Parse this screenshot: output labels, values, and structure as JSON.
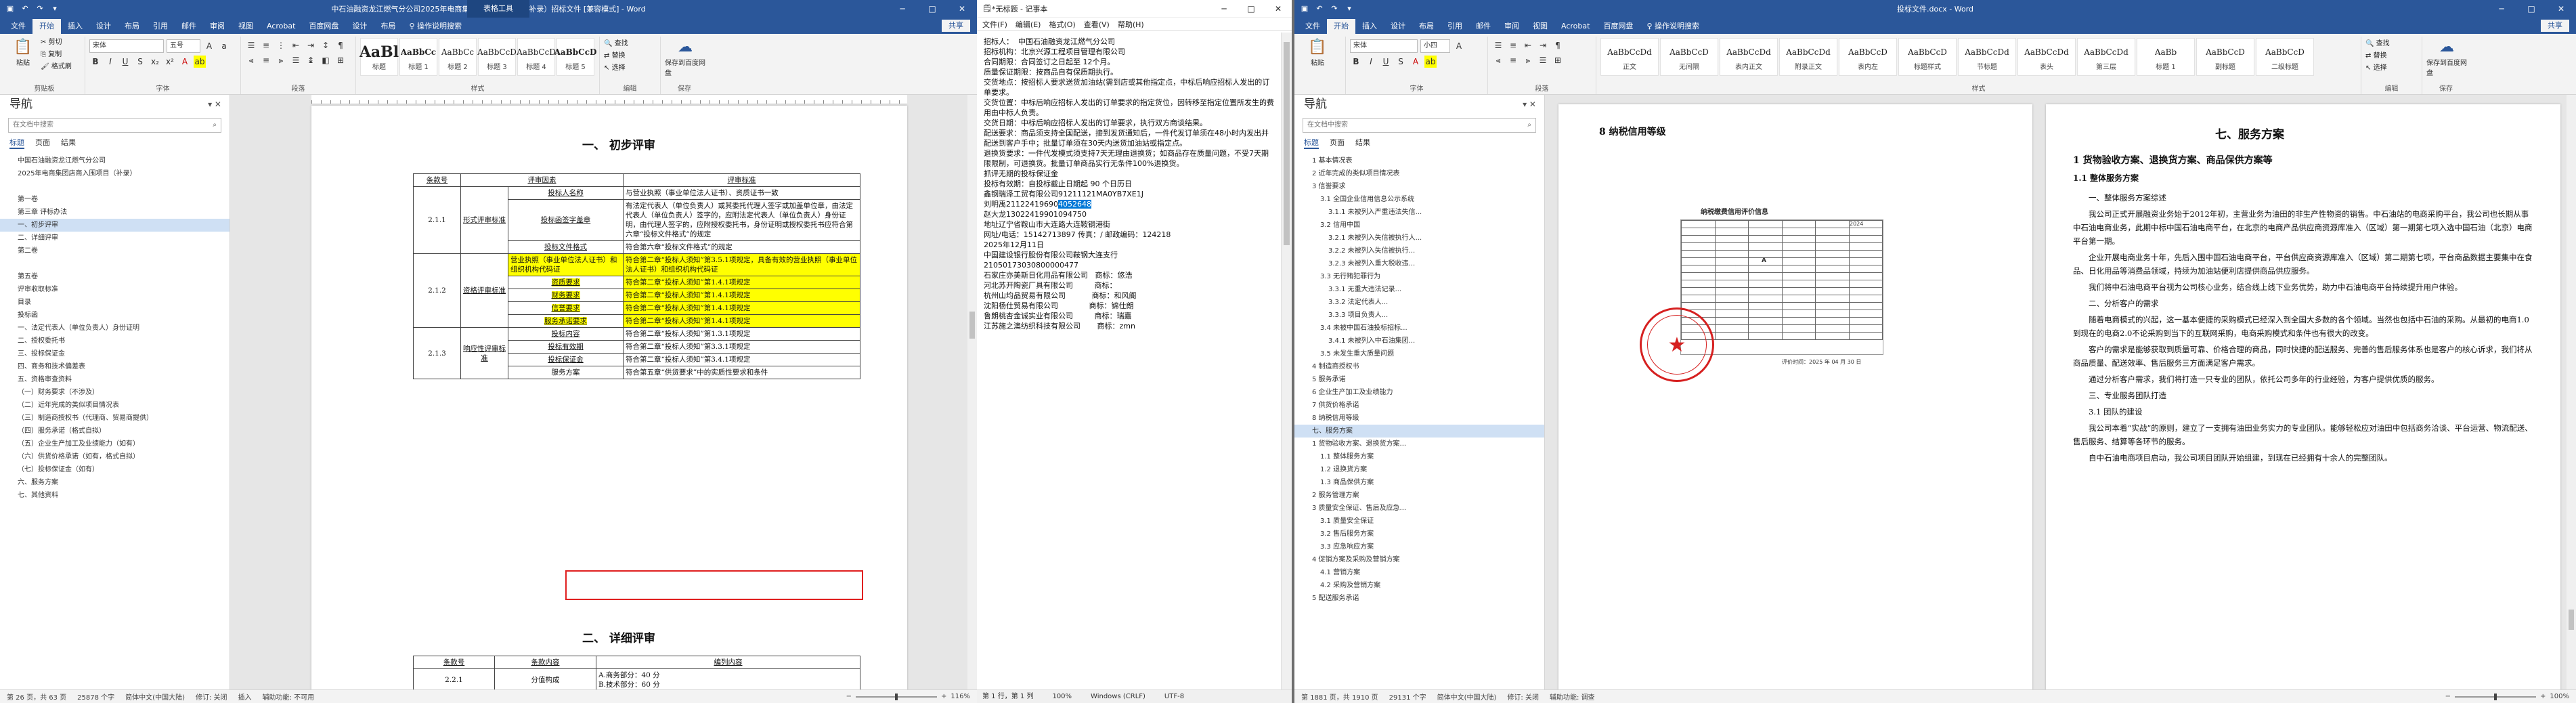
{
  "left_word": {
    "title_doc": "中石油融资龙江燃气分公司2025年电商集团店商入围项目（补录）招标文件 [兼容模式] - Word",
    "title_tool": "表格工具",
    "tabs": [
      "文件",
      "开始",
      "插入",
      "设计",
      "布局",
      "引用",
      "邮件",
      "审阅",
      "视图",
      "Acrobat",
      "百度网盘",
      "设计",
      "布局",
      "操作说明搜索"
    ],
    "share": "共享",
    "ribbon": {
      "paste": "粘贴",
      "cut": "剪切",
      "copy": "复制",
      "format_painter": "格式刷",
      "clipboard": "剪贴板",
      "font_name": "宋体",
      "font_size": "五号",
      "font_group": "字体",
      "para_group": "段落",
      "styles_group": "样式",
      "find": "查找",
      "replace": "替换",
      "select": "选择",
      "edit_group": "编辑",
      "save_baidu": "保存到百度网盘",
      "save_group": "保存"
    },
    "styles": [
      {
        "sample": "AaBl",
        "name": "标题"
      },
      {
        "sample": "AaBbCc",
        "name": "标题 1"
      },
      {
        "sample": "AaBbCc",
        "name": "标题 2"
      },
      {
        "sample": "AaBbCcD",
        "name": "标题 3"
      },
      {
        "sample": "AaBbCcD",
        "name": "标题 4"
      },
      {
        "sample": "AaBbCcD",
        "name": "标题 5"
      }
    ],
    "nav": {
      "title": "导航",
      "search_placeholder": "在文档中搜索",
      "tabs": [
        "标题",
        "页面",
        "结果"
      ],
      "items": [
        "中国石油融资龙江燃气分公司",
        "2025年电商集团店商入围项目（补录）",
        "",
        "第一卷",
        "第三章 评标办法",
        "一、初步评审",
        "二、详细评审",
        "第二卷",
        "",
        "第五卷",
        "评审收取标准",
        "目录",
        "投标函",
        "一、法定代表人（单位负责人）身份证明",
        "二、授权委托书",
        "三、投标保证金",
        "四、商务和技术偏差表",
        "五、资格审查资料",
        "（一）财务要求（不涉及）",
        "（二）近年完成的类似项目情况表",
        "（三）制造商授权书（代理商、贸易商提供）",
        "（四）服务承诺（格式自拟）",
        "（五）企业生产加工及业绩能力（如有）",
        "（六）供货价格承诺（如有，格式自拟）",
        "（七）投标保证金（如有）",
        "六、服务方案",
        "七、其他资料"
      ],
      "selected": 5
    },
    "doc": {
      "heading1": "一、    初步评审",
      "headers": [
        "条款号",
        "评审因素",
        "评审标准"
      ],
      "clause_1": "2.1.1",
      "clause_2": "2.1.2",
      "clause_3": "2.1.3",
      "cat_1": "形式评审标准",
      "cat_2": "资格评审标准",
      "cat_3": "响应性评审标准",
      "rows": [
        {
          "factor": "投标人名称",
          "std": "与营业执照（事业单位法人证书）、资质证书一致"
        },
        {
          "factor": "投标函签字盖章",
          "std": "有法定代表人（单位负责人）或其委托代理人签字或加盖单位章，由法定代表人（单位负责人）签字的，应附法定代表人（单位负责人）身份证明，由代理人签字的，应附授权委托书，身份证明或授权委托书应符合第六章“投标文件格式”的规定"
        },
        {
          "factor": "投标文件格式",
          "std": "符合第六章“投标文件格式”的规定"
        },
        {
          "factor": "营业执照（事业单位法人证书）和组织机构代码证",
          "std": "符合第二章“投标人须知”第3.5.1项规定，具备有效的营业执照（事业单位法人证书）和组织机构代码证"
        },
        {
          "factor": "资质要求",
          "std": "符合第二章“投标人须知”第1.4.1项规定"
        },
        {
          "factor": "财务要求",
          "std": "符合第二章“投标人须知”第1.4.1项规定"
        },
        {
          "factor": "信誉要求",
          "std": "符合第二章“投标人须知”第1.4.1项规定"
        },
        {
          "factor": "服务承诺要求",
          "std": "符合第二章“投标人须知”第1.4.1项规定"
        },
        {
          "factor": "投标内容",
          "std": "符合第二章“投标人须知”第1.3.1项规定"
        },
        {
          "factor": "投标有效期",
          "std": "符合第二章“投标人须知”第3.3.1项规定"
        },
        {
          "factor": "投标保证金",
          "std": "符合第二章“投标人须知”第3.4.1项规定"
        },
        {
          "factor": "服务方案",
          "std": "符合第五章“供货要求”中的实质性要求和条件"
        }
      ],
      "heading2": "二、    详细评审",
      "headers2": [
        "条款号",
        "条款内容",
        "编列内容"
      ],
      "d_clause": "2.2.1",
      "d_factor": "分值构成",
      "d_std": "A.商务部分：40 分\nB.技术部分：60 分"
    },
    "status": {
      "page": "第 26 页，共 63 页",
      "words": "25878 个字",
      "lang": "简体中文(中国大陆)",
      "track": "修订: 关闭",
      "insert": "插入",
      "access": "辅助功能: 不可用",
      "zoom": "116%"
    }
  },
  "notepad": {
    "title": "*无标题 - 记事本",
    "menu": [
      "文件(F)",
      "编辑(E)",
      "格式(O)",
      "查看(V)",
      "帮助(H)"
    ],
    "lines": [
      "招标人：  中国石油融资龙江燃气分公司",
      "",
      "招标机构：北京兴源工程项目管理有限公司",
      "",
      "合同期限：合同签订之日起至 12个月。",
      "",
      "质量保证期限：按商品自有保质期执行。",
      "",
      "交货地点：按招标人要求送货加油站(需到店或其他指定点，中标后响应招标人发出的订单要求。",
      "交货位置：中标后响应招标人发出的订单要求的指定货位，因转移至指定位置所发生的费用由中标人负责。",
      "",
      "交货日期：中标后响应招标人发出的订单要求，执行双方商谈结果。",
      "",
      "配送要求：商品须支持全国配送，接到发货通知后，一件代发订单须在48小时内发出并配送到客户手中；批量订单须在30天内送货加油站或指定点。",
      "",
      "退换货要求：一件代发模式须支持7天无理由退换货；如商品存在质量问题，不受7天期限限制，可退换货。批量订单商品实行无条件100%退换货。",
      "",
      "抓评无期的投标保证金",
      "",
      "投标有效期：自投标截止日期起 90 个日历日",
      "",
      "鑫钢瑞泽工贸有限公司91211121MA0YB7XE1J",
      "刘明禹21122419690",
      "赵大龙13022419901094750",
      "地址辽宁省鞍山市大连路大连鞍钢港街",
      "网址/电话：15142713897 传真：/ 邮政编码：124218",
      "2025年12月11日",
      "",
      "中国建设银行股份有限公司鞍钢大连支行",
      "21050173030800000477",
      "",
      "石家庄亦美斯日化用品有限公司   商标：悠浩",
      "河北苏开陶瓷厂具有限公司         商标：",
      "杭州山均品贸易有限公司           商标：和风阁",
      "沈阳杨仕贸易有限公司             商标：锦仕朗",
      "鲁朗桃杏金诚实业有限公司         商标：瑞嘉",
      "江苏施之澳纺织科技有限公司       商标：zmn"
    ],
    "selected_text": "4052648",
    "status": [
      "第 1 行，第 1 列",
      "100%",
      "Windows (CRLF)",
      "UTF-8"
    ]
  },
  "right_word": {
    "title_doc": "投标文件.docx - Word",
    "tabs": [
      "文件",
      "开始",
      "插入",
      "设计",
      "布局",
      "引用",
      "邮件",
      "审阅",
      "视图",
      "Acrobat",
      "百度网盘",
      "操作说明搜索"
    ],
    "share": "共享",
    "ribbon": {
      "paste": "粘贴",
      "font_name": "宋体",
      "font_size": "小四",
      "font_group": "字体",
      "para_group": "段落",
      "styles_group": "样式",
      "edit_group": "编辑",
      "save_group": "保存",
      "find": "查找",
      "replace": "替换",
      "select": "选择",
      "save_baidu": "保存到百度网盘"
    },
    "styles": [
      {
        "sample": "AaBbCcDd",
        "name": "正文"
      },
      {
        "sample": "AaBbCcD",
        "name": "无间隔"
      },
      {
        "sample": "AaBbCcDd",
        "name": "表内正文"
      },
      {
        "sample": "AaBbCcDd",
        "name": "附录正文"
      },
      {
        "sample": "AaBbCcD",
        "name": "表内左"
      },
      {
        "sample": "AaBbCcD",
        "name": "标题样式"
      },
      {
        "sample": "AaBbCcDd",
        "name": "节标题"
      },
      {
        "sample": "AaBbCcDd",
        "name": "表头"
      },
      {
        "sample": "AaBbCcDd",
        "name": "第三层"
      },
      {
        "sample": "AaBb",
        "name": "标题 1"
      },
      {
        "sample": "AaBbCcD",
        "name": "副标题"
      },
      {
        "sample": "AaBbCcD",
        "name": "二级标题"
      }
    ],
    "nav": {
      "title": "导航",
      "search_placeholder": "在文档中搜索",
      "tabs": [
        "标题",
        "页面",
        "结果"
      ],
      "items": [
        "1 基本情况表",
        "2 近年完成的类似项目情况表",
        "3 信誉要求",
        "3.1 全国企业信用信息公示系统",
        "3.1.1 未被列入严重违法失信...",
        "3.2 信用中国",
        "3.2.1 未被列入失信被执行人...",
        "3.2.2 未被列入失信被执行...",
        "3.2.3 未被列入重大税收违...",
        "3.3 无行贿犯罪行为",
        "3.3.1 无重大违法记录...",
        "3.3.2 法定代表人...",
        "3.3.3 项目负责人...",
        "3.4 未被中国石油投标招标...",
        "3.4.1 未被列入中石油集团...",
        "3.5 未发生重大质量问题",
        "4 制造商授权书",
        "5 服务承诺",
        "6 企业生产加工及业绩能力",
        "7 供货价格承诺",
        "8 纳税信用等级",
        "七、服务方案",
        "1 货物验收方案、退换货方案...",
        "1.1 整体服务方案",
        "1.2 退换货方案",
        "1.3 商品保供方案",
        "2 服务管理方案",
        "3 质量安全保证、售后及应急...",
        "3.1 质量安全保证",
        "3.2 售后服务方案",
        "3.3 应急响应方案",
        "4 促销方案及采购及营销方案",
        "4.1 营销方案",
        "4.2 采购及营销方案",
        "5 配送服务承诺"
      ],
      "selected": 21
    },
    "page1": {
      "heading": "8   纳税信用等级",
      "cert_title": "纳税缴费信用评价信息",
      "cert_year": "2024",
      "cert_level": "A",
      "cert_footer": "评价时间：2025 年 04 月 30 日"
    },
    "page2": {
      "h1": "七、服务方案",
      "h2": "1   货物验收方案、退换货方案、商品保供方案等",
      "h3": "1.1   整体服务方案",
      "p": [
        "一、整体服务方案综述",
        "我公司正式开展融资业务始于2012年初，主营业务为油田的非生产性物资的销售。中石油站的电商采购平台，我公司也长期从事中石油电商业务，此期中标中国石油电商平台，在北京的电商产品供应商资源库准入（区域）第一期第七项入选中国石油（北京）电商平台第一期。",
        "企业开展电商业务十年，先后入围中国石油电商平台，平台供应商资源库准入（区域）第二期第七项，平台商品数据主要集中在食品、日化用品等消费品领域，持续为加油站便利店提供商品供应服务。",
        "我们将中石油电商平台视为公司核心业务，结合线上线下业务优势，助力中石油电商平台持续提升用户体验。",
        "二、分析客户的需求",
        "随着电商模式的兴起，这一基本便捷的采购模式已经深入到全国大多数的各个领域。当然也包括中石油的采购。从最初的电商1.0到现在的电商2.0不论采购到当下的互联网采购，电商采购模式和条件也有很大的改变。",
        "客户的需求是能够获取到质量可靠、价格合理的商品，同时快捷的配送服务、完善的售后服务体系也是客户的核心诉求，我们将从商品质量、配送效率、售后服务三方面满足客户需求。",
        "通过分析客户需求，我们将打造一只专业的团队，依托公司多年的行业经验，为客户提供优质的服务。",
        "三、专业服务团队打造",
        "3.1 团队的建设",
        "我公司本着“实战”的原则，建立了一支拥有油田业务实力的专业团队。能够轻松应对油田中包括商务洽谈、平台运营、物流配送、售后服务、结算等各环节的服务。",
        "自中石油电商项目启动，我公司项目团队开始组建，到现在已经拥有十余人的完整团队。"
      ]
    },
    "status": {
      "page": "第 1881 页，共 1910 页",
      "words": "29131 个字",
      "lang": "简体中文(中国大陆)",
      "track": "修订: 关闭",
      "access": "辅助功能: 调查",
      "zoom": "100%"
    }
  },
  "colors": {
    "word_blue": "#2b579a",
    "highlight": "#ffff00",
    "red_box": "#e02020",
    "selection": "#0078d7",
    "link_red": "#c00000"
  }
}
